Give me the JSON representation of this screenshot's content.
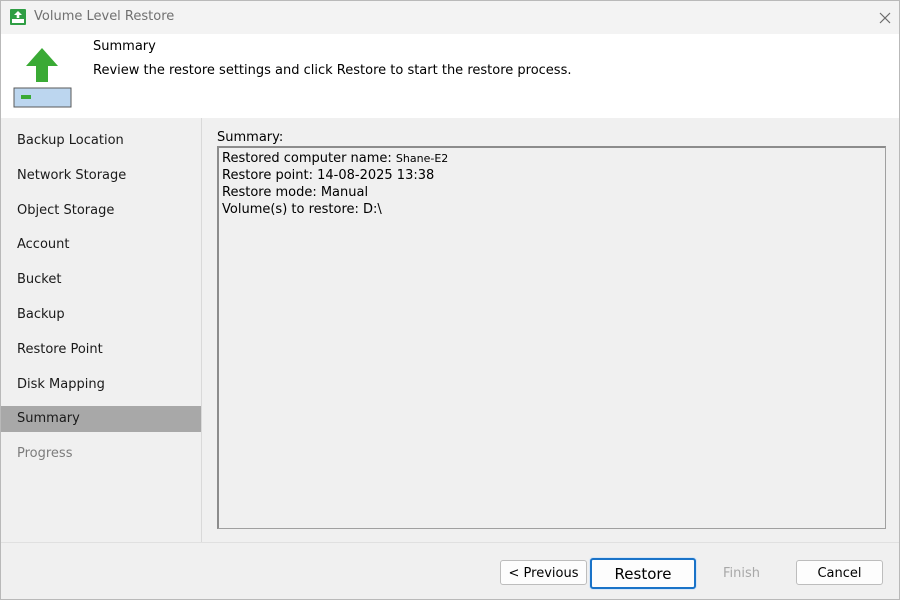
{
  "window": {
    "title": "Volume Level Restore"
  },
  "header": {
    "title": "Summary",
    "description": "Review the restore settings and click Restore to start the restore process."
  },
  "sidebar": {
    "items": [
      {
        "label": "Backup Location",
        "state": "normal"
      },
      {
        "label": "Network Storage",
        "state": "normal"
      },
      {
        "label": "Object Storage",
        "state": "normal"
      },
      {
        "label": "Account",
        "state": "normal"
      },
      {
        "label": "Bucket",
        "state": "normal"
      },
      {
        "label": "Backup",
        "state": "normal"
      },
      {
        "label": "Restore Point",
        "state": "normal"
      },
      {
        "label": "Disk Mapping",
        "state": "normal"
      },
      {
        "label": "Summary",
        "state": "active"
      },
      {
        "label": "Progress",
        "state": "disabled"
      }
    ]
  },
  "summary": {
    "label": "Summary:",
    "computer_name_label": "Restored computer name: ",
    "computer_name": "Shane-E2",
    "restore_point": "Restore point: 14-08-2025 13:38",
    "restore_mode": "Restore mode: Manual",
    "volumes": "Volume(s) to restore: D:\\"
  },
  "buttons": {
    "previous": "< Previous",
    "restore": "Restore",
    "finish": "Finish",
    "cancel": "Cancel"
  },
  "icons": {
    "app": "upload-restore-icon",
    "header": "restore-arrow-icon",
    "close": "close-icon"
  },
  "colors": {
    "accent": "#1a73c8",
    "arrow_green": "#3aaa35",
    "active_nav": "#a8a8a8"
  }
}
